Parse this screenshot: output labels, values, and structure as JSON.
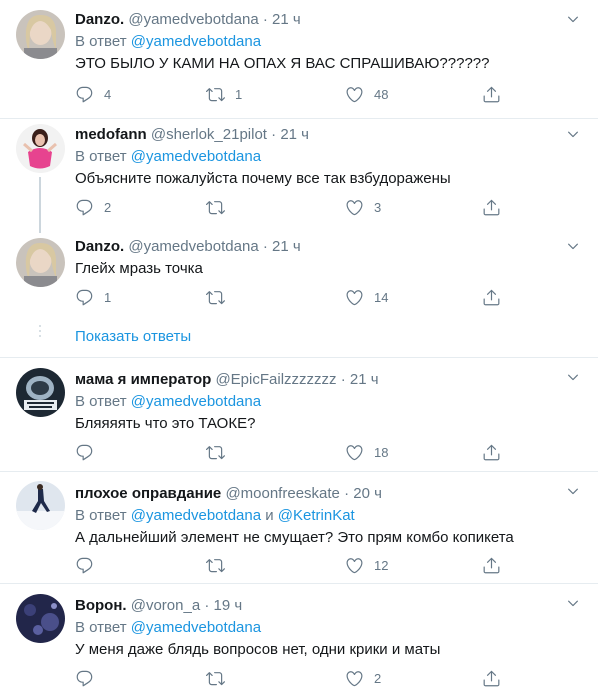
{
  "reply_label": "В ответ",
  "and_label": "и",
  "show_replies": "Показать ответы",
  "tweets": [
    {
      "name": "Danzo.",
      "handle": "@yamedvebotdana",
      "dot": "·",
      "time": "21 ч",
      "reply_to": "@yamedvebotdana",
      "text": "ЭТО БЫЛО У КАМИ НА ОПАХ Я ВАС СПРАШИВАЮ??????",
      "replies": "4",
      "retweets": "1",
      "likes": "48"
    },
    {
      "name": "medofann",
      "handle": "@sherlok_21pilot",
      "dot": "·",
      "time": "21 ч",
      "reply_to": "@yamedvebotdana",
      "text": "Объясните пожалуйста почему все так взбудоражены",
      "replies": "2",
      "retweets": "",
      "likes": "3"
    },
    {
      "name": "Danzo.",
      "handle": "@yamedvebotdana",
      "dot": "·",
      "time": "21 ч",
      "text": "Глейх мразь точка",
      "replies": "1",
      "retweets": "",
      "likes": "14"
    },
    {
      "name": "мама я император",
      "handle": "@EpicFailzzzzzzz",
      "dot": "·",
      "time": "21 ч",
      "reply_to": "@yamedvebotdana",
      "text": "Бляяяять что это ТАОКЕ?",
      "replies": "",
      "retweets": "",
      "likes": "18"
    },
    {
      "name": "плохое оправдание",
      "handle": "@moonfreeskate",
      "dot": "·",
      "time": "20 ч",
      "reply_to": "@yamedvebotdana",
      "reply_to_2": "@KetrinKat",
      "text": "А дальнейший элемент не смущает? Это прям комбо копикета",
      "replies": "",
      "retweets": "",
      "likes": "12"
    },
    {
      "name": "Ворон.",
      "handle": "@voron_a",
      "dot": "·",
      "time": "19 ч",
      "reply_to": "@yamedvebotdana",
      "text": "У меня даже блядь вопросов нет, одни крики и маты",
      "replies": "",
      "retweets": "",
      "likes": "2"
    }
  ],
  "colors": {
    "text": "#14171a",
    "secondary": "#657786",
    "link": "#1b95e0",
    "divider": "#e6ecf0",
    "thread_line": "#ccd6dd"
  },
  "icons": [
    "reply-icon",
    "retweet-icon",
    "like-icon",
    "share-icon",
    "caret-down-icon"
  ]
}
